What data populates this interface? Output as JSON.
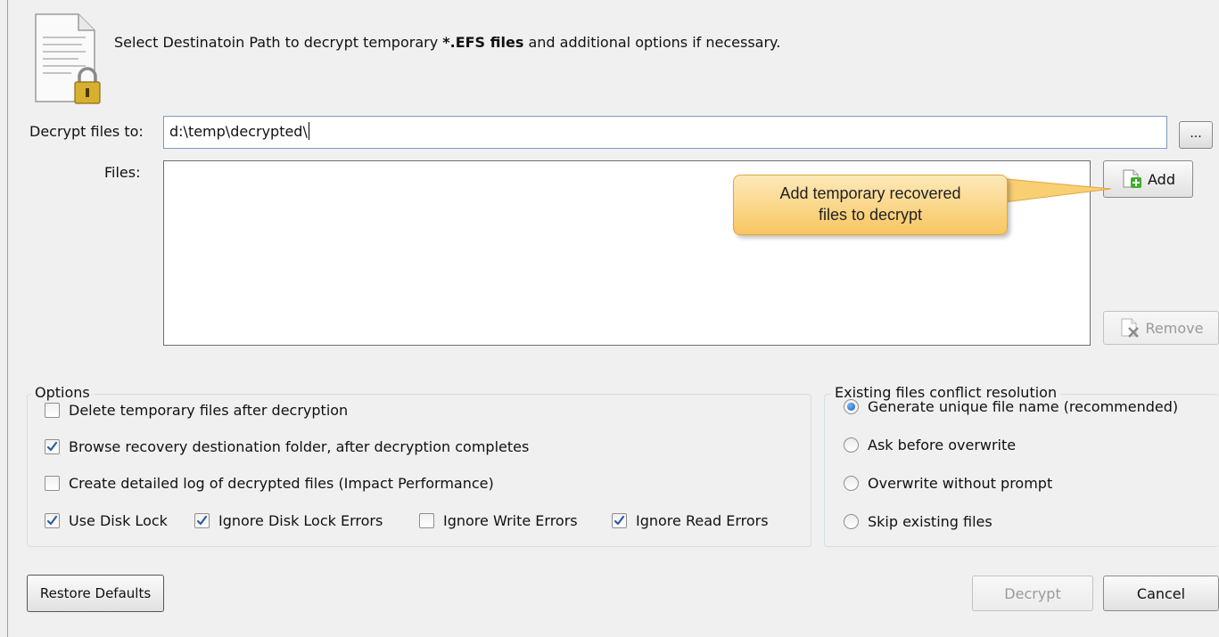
{
  "header": {
    "text_before": "Select Destinatoin Path to decrypt temporary ",
    "text_bold": "*.EFS files",
    "text_after": " and additional options if necessary."
  },
  "destination": {
    "label": "Decrypt files to:",
    "value": "d:\\temp\\decrypted\\",
    "browse_label": "..."
  },
  "files": {
    "label": "Files:",
    "add_label": "Add",
    "remove_label": "Remove"
  },
  "callout": {
    "line1": "Add temporary recovered",
    "line2": "files to decrypt"
  },
  "options": {
    "title": "Options",
    "items": [
      {
        "label": "Delete temporary files after decryption",
        "checked": false
      },
      {
        "label": "Browse recovery destionation folder, after decryption completes",
        "checked": true
      },
      {
        "label": "Create detailed log of decrypted files (Impact Performance)",
        "checked": false
      }
    ],
    "row": [
      {
        "label": "Use Disk Lock",
        "checked": true
      },
      {
        "label": "Ignore Disk Lock Errors",
        "checked": true
      },
      {
        "label": "Ignore Write Errors",
        "checked": false
      },
      {
        "label": "Ignore Read Errors",
        "checked": true
      }
    ]
  },
  "conflict": {
    "title": "Existing files conflict resolution",
    "items": [
      {
        "label": "Generate unique file name (recommended)",
        "selected": true
      },
      {
        "label": "Ask before overwrite",
        "selected": false
      },
      {
        "label": "Overwrite without prompt",
        "selected": false
      },
      {
        "label": "Skip existing files",
        "selected": false
      }
    ]
  },
  "footer": {
    "restore_label": "Restore Defaults",
    "decrypt_label": "Decrypt",
    "cancel_label": "Cancel"
  },
  "colors": {
    "callout_fill": "#f8c662",
    "checkbox_check": "#2a5da8",
    "radio_dot": "#1c5fb8"
  }
}
